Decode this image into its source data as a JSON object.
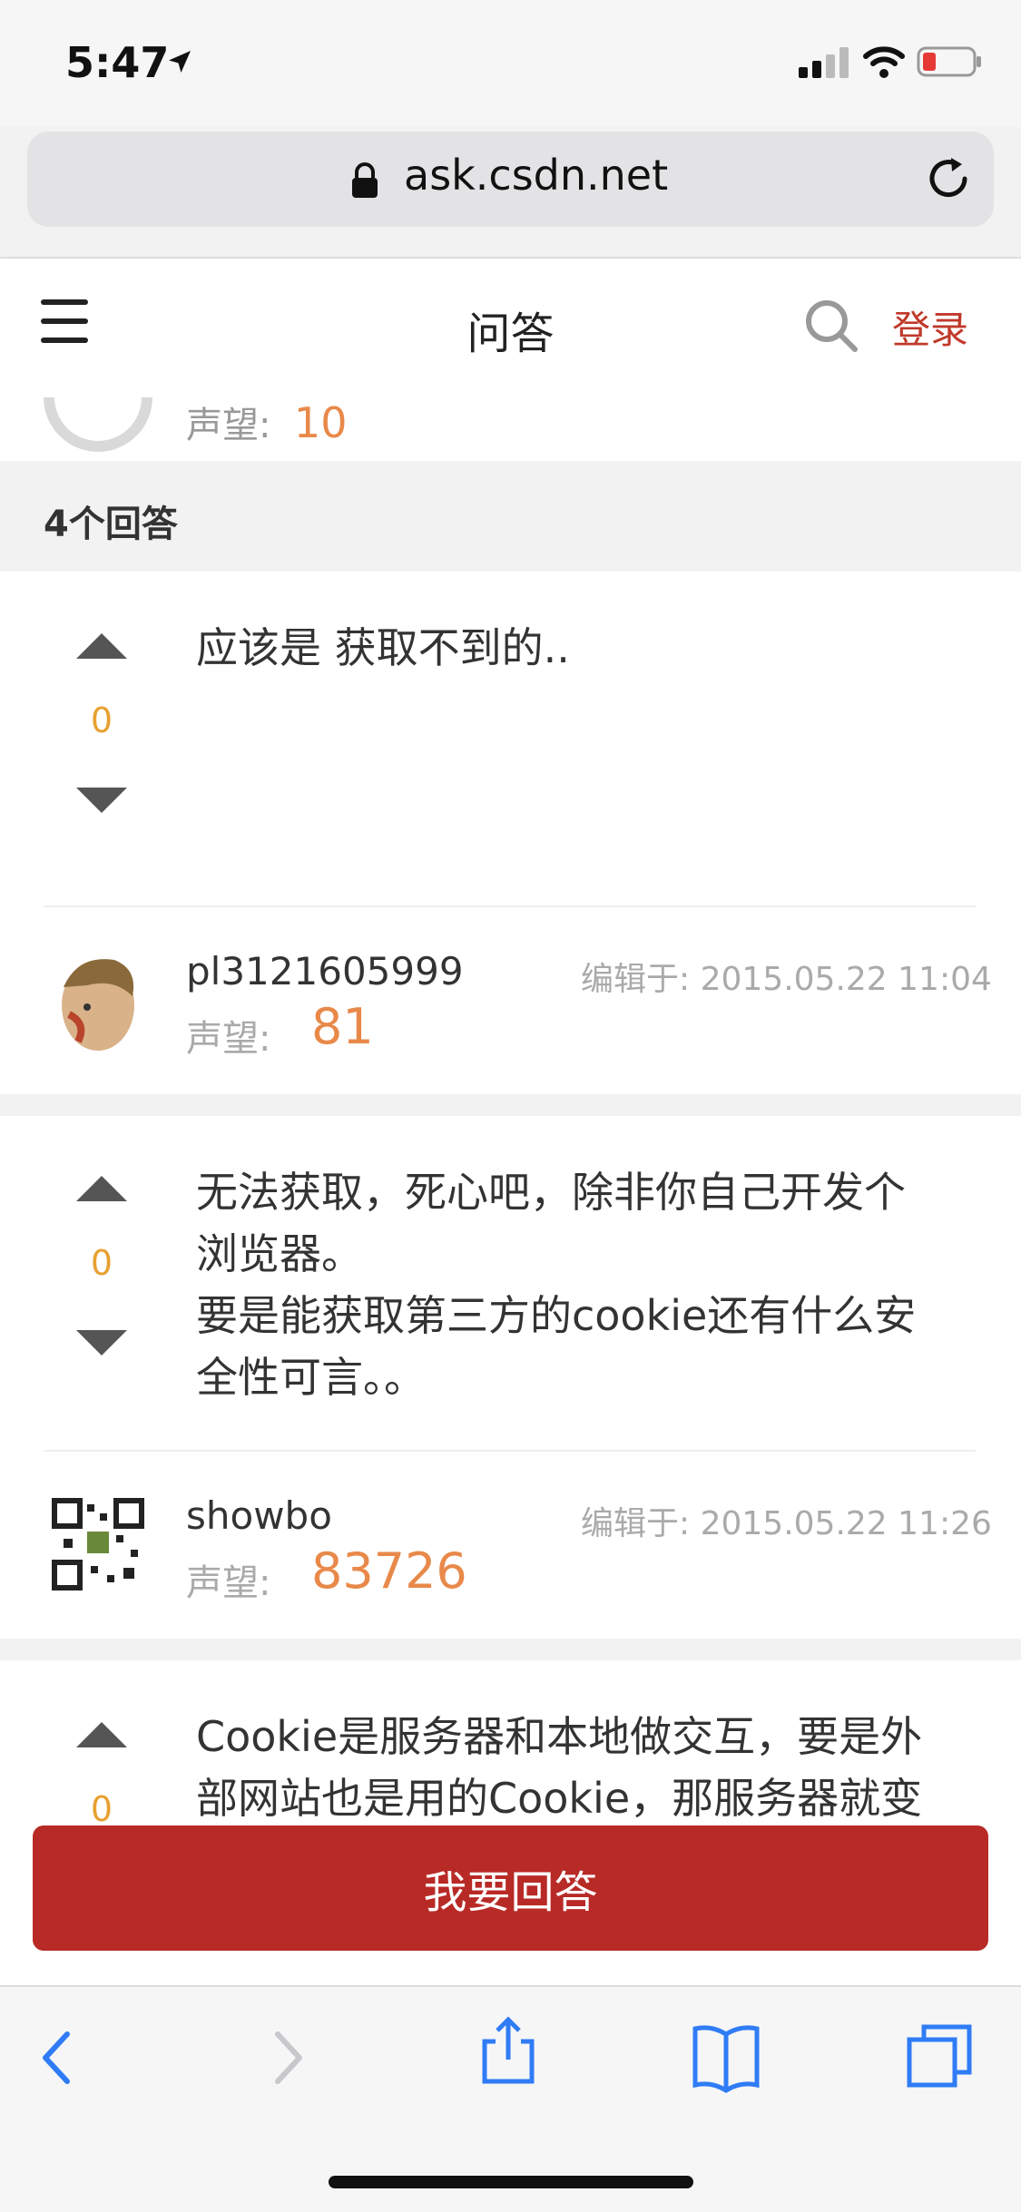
{
  "status_bar": {
    "time": "5:47"
  },
  "browser": {
    "url": "ask.csdn.net"
  },
  "site_header": {
    "title": "问答",
    "login": "登录"
  },
  "previous_block": {
    "reputation_label": "声望:",
    "reputation_value": "10"
  },
  "answers_count": "4个回答",
  "answers": [
    {
      "votes": "0",
      "text": "应该是 获取不到的..",
      "username": "pl3121605999",
      "edited": "编辑于: 2015.05.22 11:04",
      "reputation_label": "声望:",
      "reputation_value": "81"
    },
    {
      "votes": "0",
      "text_lines": [
        "无法获取，死心吧，除非你自己开发个",
        "浏览器。",
        "要是能获取第三方的cookie还有什么安",
        "全性可言。。"
      ],
      "username": "showbo",
      "edited": "编辑于: 2015.05.22 11:26",
      "reputation_label": "声望:",
      "reputation_value": "83726"
    },
    {
      "votes": "0",
      "text_lines": [
        "Cookie是服务器和本地做交互，要是外",
        "部网站也是用的Cookie，那服务器就变"
      ]
    }
  ],
  "answer_button": "我要回答",
  "colors": {
    "brand_red": "#b82a26",
    "vote_orange": "#e8a030",
    "reputation_orange": "#e8894a",
    "ios_blue": "#2f7cf6"
  }
}
